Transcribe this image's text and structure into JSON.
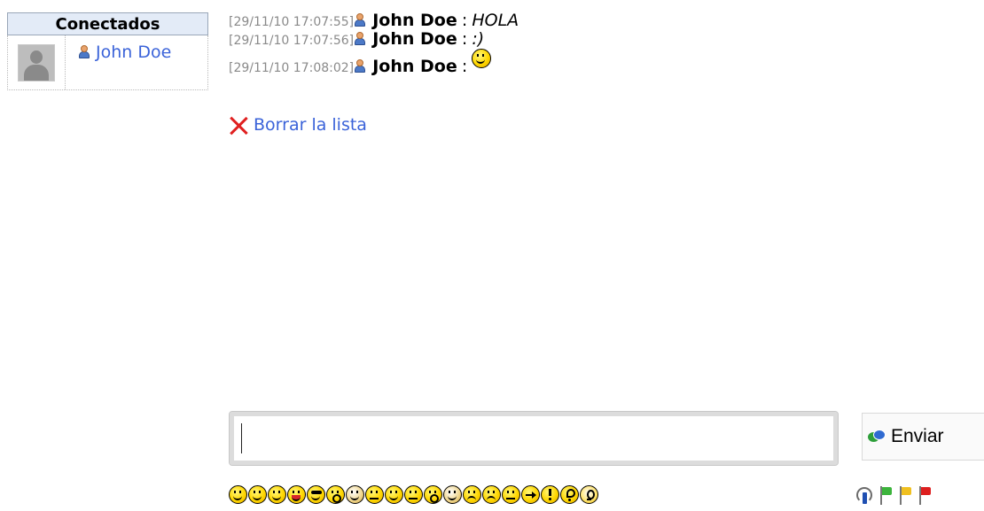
{
  "users_panel": {
    "header": "Conectados",
    "users": [
      {
        "name": "John Doe"
      }
    ]
  },
  "chat": {
    "messages": [
      {
        "time": "[29/11/10 17:07:55]",
        "user": "John Doe",
        "separator": ":",
        "text": "HOLA",
        "emoticon": null
      },
      {
        "time": "[29/11/10 17:07:56]",
        "user": "John Doe",
        "separator": ":",
        "text": ":)",
        "emoticon": null
      },
      {
        "time": "[29/11/10 17:08:02]",
        "user": "John Doe",
        "separator": ":",
        "text": "",
        "emoticon": "smiley"
      }
    ]
  },
  "actions": {
    "clear_label": "Borrar la lista"
  },
  "composer": {
    "input_value": "",
    "send_label": "Enviar"
  },
  "emoticons": [
    "grin",
    "big-grin",
    "smile",
    "tongue",
    "cool",
    "surprised",
    "wave-hand",
    "confused",
    "happy",
    "neutral",
    "blush",
    "facepalm",
    "crying",
    "sad",
    "angry",
    "arrow",
    "exclamation",
    "question",
    "idea"
  ],
  "status_icons": {
    "info": "info-icon",
    "flags": [
      {
        "name": "green-flag",
        "color": "#3cb43c"
      },
      {
        "name": "yellow-flag",
        "color": "#f0c020"
      },
      {
        "name": "red-flag",
        "color": "#dd1f1f"
      }
    ]
  },
  "colors": {
    "link": "#3b63d9",
    "header_bg": "#e3ebf7",
    "timestamp": "#8a8a8a",
    "clear_icon": "#e02020"
  }
}
